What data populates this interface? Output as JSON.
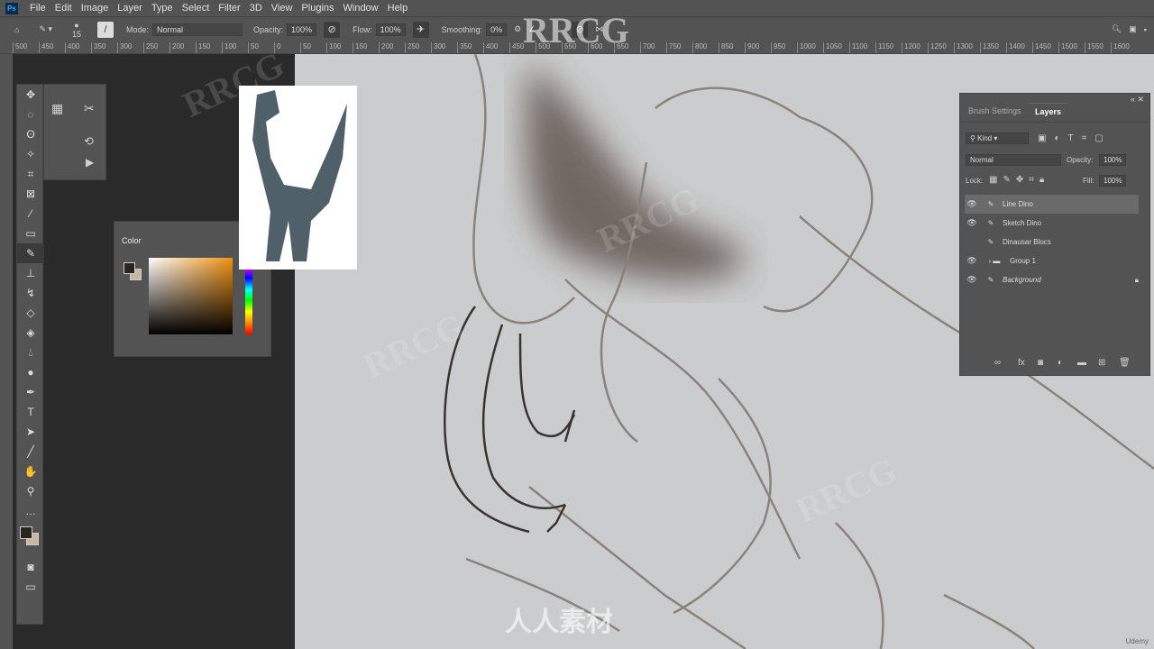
{
  "menu": [
    "File",
    "Edit",
    "Image",
    "Layer",
    "Type",
    "Select",
    "Filter",
    "3D",
    "View",
    "Plugins",
    "Window",
    "Help"
  ],
  "options": {
    "brush_size": "15",
    "mode_label": "Mode:",
    "mode": "Normal",
    "opacity_label": "Opacity:",
    "opacity": "100%",
    "flow_label": "Flow:",
    "flow": "100%",
    "smoothing_label": "Smoothing:",
    "smoothing": "0%"
  },
  "ruler": [
    "500",
    "450",
    "400",
    "350",
    "300",
    "250",
    "200",
    "150",
    "100",
    "50",
    "0",
    "50",
    "100",
    "150",
    "200",
    "250",
    "300",
    "350",
    "400",
    "450",
    "500",
    "550",
    "600",
    "650",
    "700",
    "750",
    "800",
    "850",
    "900",
    "950",
    "1000",
    "1050",
    "1100",
    "1150",
    "1200",
    "1250",
    "1300",
    "1350",
    "1400",
    "1450",
    "1500",
    "1550",
    "1600"
  ],
  "color_panel": {
    "title": "Color",
    "fg": "#2a2420",
    "bg": "#c8b8a0",
    "hue": "#f09010"
  },
  "layers_panel": {
    "tabs": [
      "Brush Settings",
      "Layers"
    ],
    "kind": "Kind",
    "blend": "Normal",
    "opacity_label": "Opacity:",
    "opacity": "100%",
    "lock_label": "Lock:",
    "fill_label": "Fill:",
    "fill": "100%",
    "layers": [
      {
        "name": "Line Dino",
        "visible": true,
        "selected": true
      },
      {
        "name": "Sketch Dino",
        "visible": true
      },
      {
        "name": "Dinausar Blocs",
        "visible": false
      },
      {
        "name": "Group 1",
        "visible": true
      },
      {
        "name": "Background",
        "visible": true,
        "locked": true
      }
    ]
  },
  "watermarks": [
    "RRCG",
    "人人素材"
  ],
  "footer": "Udemy"
}
